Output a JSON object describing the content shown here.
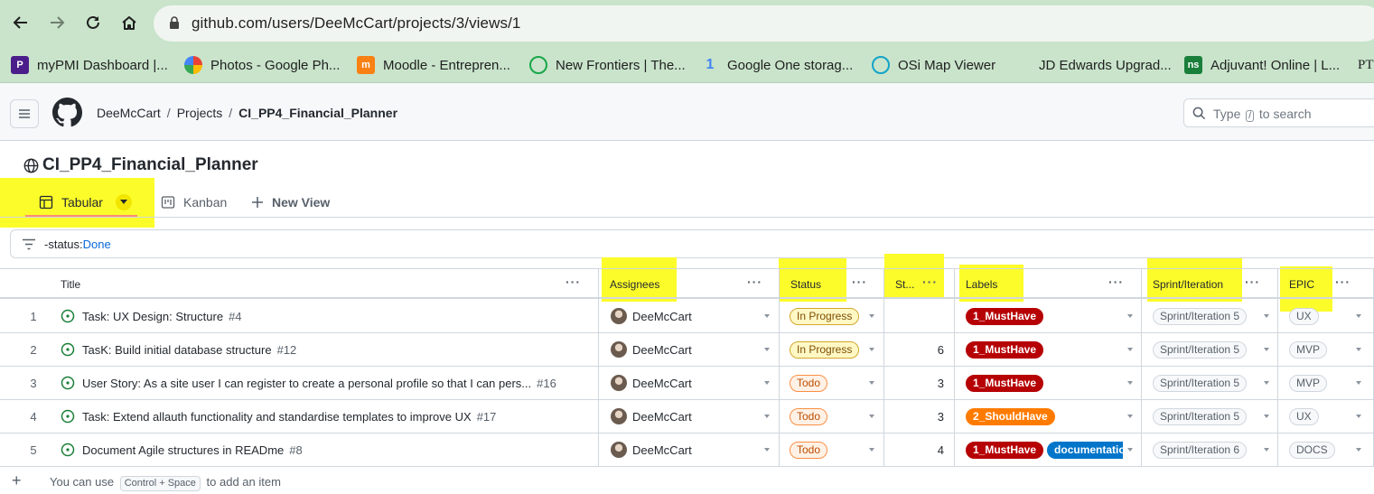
{
  "browser": {
    "url": "github.com/users/DeeMcCart/projects/3/views/1",
    "bookmarks": [
      {
        "label": "myPMI Dashboard |...",
        "icon": "pmi-icon"
      },
      {
        "label": "Photos - Google Ph...",
        "icon": "google-photos-icon"
      },
      {
        "label": "Moodle - Entrepren...",
        "icon": "moodle-icon"
      },
      {
        "label": "New Frontiers | The...",
        "icon": "new-frontiers-icon"
      },
      {
        "label": "Google One storag...",
        "icon": "google-one-icon"
      },
      {
        "label": "OSi Map Viewer",
        "icon": "osi-icon"
      },
      {
        "label": "JD Edwards Upgrad...",
        "icon": "none"
      },
      {
        "label": "Adjuvant! Online | L...",
        "icon": "ns-icon"
      },
      {
        "label": "PT",
        "icon": "pt-icon"
      }
    ]
  },
  "header": {
    "breadcrumb": [
      "DeeMcCart",
      "Projects",
      "CI_PP4_Financial_Planner"
    ],
    "search_prefix": "Type",
    "search_key": "/",
    "search_suffix": "to search"
  },
  "project": {
    "title": "CI_PP4_Financial_Planner",
    "tabs": [
      "Tabular",
      "Kanban",
      "New View"
    ],
    "active_tab": "Tabular",
    "filter_key": "-status:",
    "filter_value": "Done"
  },
  "table": {
    "columns": [
      "Title",
      "Assignees",
      "Status",
      "St...",
      "Labels",
      "Sprint/Iteration",
      "EPIC"
    ],
    "rows": [
      {
        "num": "1",
        "title": "Task: UX Design: Structure",
        "issue": "#4",
        "assignee": "DeeMcCart",
        "status": "In Progress",
        "estimate": "",
        "labels": [
          "1_MustHave"
        ],
        "sprint": "Sprint/Iteration 5",
        "epic": "UX"
      },
      {
        "num": "2",
        "title": "TasK: Build initial database structure",
        "issue": "#12",
        "assignee": "DeeMcCart",
        "status": "In Progress",
        "estimate": "6",
        "labels": [
          "1_MustHave"
        ],
        "sprint": "Sprint/Iteration 5",
        "epic": "MVP"
      },
      {
        "num": "3",
        "title": "User Story: As a site user I can register to create a personal profile so that I can pers...",
        "issue": "#16",
        "assignee": "DeeMcCart",
        "status": "Todo",
        "estimate": "3",
        "labels": [
          "1_MustHave"
        ],
        "sprint": "Sprint/Iteration 5",
        "epic": "MVP"
      },
      {
        "num": "4",
        "title": "Task: Extend allauth functionality and standardise templates to improve UX",
        "issue": "#17",
        "assignee": "DeeMcCart",
        "status": "Todo",
        "estimate": "3",
        "labels": [
          "2_ShouldHave"
        ],
        "sprint": "Sprint/Iteration 5",
        "epic": "UX"
      },
      {
        "num": "5",
        "title": "Document Agile structures in READme",
        "issue": "#8",
        "assignee": "DeeMcCart",
        "status": "Todo",
        "estimate": "4",
        "labels": [
          "1_MustHave",
          "documentation"
        ],
        "sprint": "Sprint/Iteration 6",
        "epic": "DOCS"
      }
    ]
  },
  "footer": {
    "prefix": "You can use",
    "shortcut": "Control + Space",
    "suffix": "to add an item"
  },
  "colors": {
    "highlight": "#fcfc2a",
    "must_have": "#b60205",
    "should_have": "#ff7b00",
    "documentation": "#0075ca",
    "browser_chrome": "#c9e4cb"
  }
}
